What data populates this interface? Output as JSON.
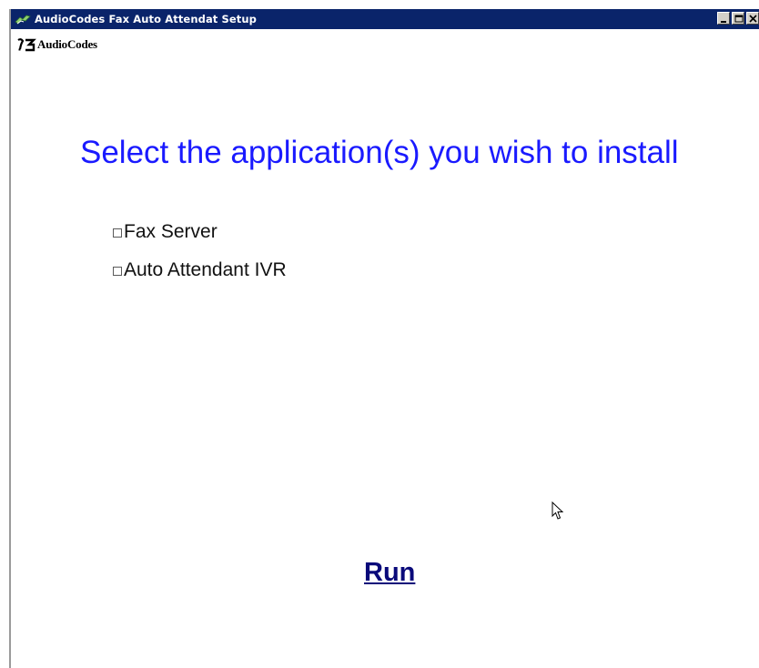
{
  "window": {
    "title": "AudioCodes Fax Auto Attendat Setup"
  },
  "logo": {
    "text": "AudioCodes"
  },
  "main": {
    "heading": "Select the application(s) you wish to install",
    "options": [
      {
        "label": "Fax Server",
        "checked": false
      },
      {
        "label": "Auto Attendant IVR",
        "checked": false
      }
    ],
    "run_label": "Run"
  },
  "colors": {
    "titlebar": "#0a246a",
    "heading": "#1a1aff",
    "run_link": "#0a0a7a"
  },
  "icons": {
    "app": "app-window-icon",
    "logo": "audiocodes-logo-icon",
    "minimize": "minimize-icon",
    "maximize": "maximize-icon",
    "close": "close-icon",
    "cursor": "mouse-pointer-icon"
  }
}
